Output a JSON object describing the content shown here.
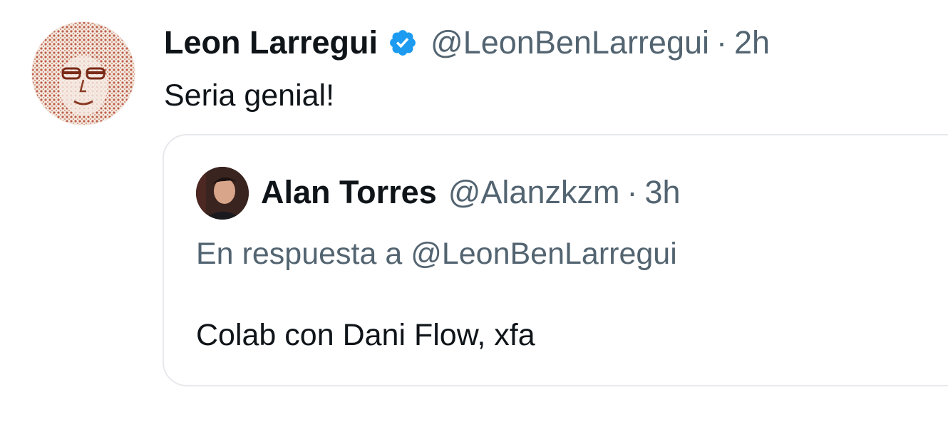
{
  "tweet": {
    "author_name": "Leon Larregui",
    "verified_icon": "verified-badge-icon",
    "handle": "@LeonBenLarregui",
    "separator": "·",
    "time": "2h",
    "text": "Seria genial!"
  },
  "quoted_tweet": {
    "author_name": "Alan Torres",
    "handle": "@Alanzkzm",
    "separator": "·",
    "time": "3h",
    "reply_to": "En respuesta a @LeonBenLarregui",
    "text": "Colab con Dani Flow, xfa"
  },
  "colors": {
    "text_primary": "#0f1419",
    "text_secondary": "#536471",
    "verified_blue": "#1d9bf0",
    "card_border": "#e7e9ec"
  }
}
